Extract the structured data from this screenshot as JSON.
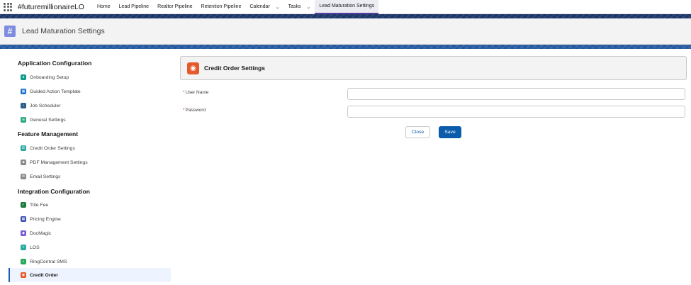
{
  "app": {
    "name": "#futuremillionaireLO",
    "nav": [
      {
        "label": "Home",
        "dropdown": false
      },
      {
        "label": "Lead Pipeline",
        "dropdown": false
      },
      {
        "label": "Realtor Pipeline",
        "dropdown": false
      },
      {
        "label": "Retention Pipeline",
        "dropdown": false
      },
      {
        "label": "Calendar",
        "dropdown": true
      },
      {
        "label": "Tasks",
        "dropdown": true
      },
      {
        "label": "Lead Maturation Settings",
        "dropdown": false,
        "active": true
      }
    ]
  },
  "page": {
    "title": "Lead Maturation Settings"
  },
  "sidebar": {
    "sections": [
      {
        "title": "Application Configuration",
        "items": [
          {
            "label": "Onboarding Setup",
            "icon": "onboarding-icon",
            "color": "#0f9d8a"
          },
          {
            "label": "Guided Action Template",
            "icon": "template-icon",
            "color": "#1b6fc9"
          },
          {
            "label": "Job Scheduler",
            "icon": "scheduler-icon",
            "color": "#2f5d8a"
          },
          {
            "label": "General Settings",
            "icon": "settings-icon",
            "color": "#2aa87f"
          }
        ]
      },
      {
        "title": "Feature Management",
        "items": [
          {
            "label": "Credit Order Settings",
            "icon": "credit-settings-icon",
            "color": "#2aa8a0"
          },
          {
            "label": "PDF Management Settings",
            "icon": "pdf-icon",
            "color": "#8a8a8a"
          },
          {
            "label": "Email Settings",
            "icon": "email-icon",
            "color": "#8a8a8a"
          }
        ]
      },
      {
        "title": "Integration Configuration",
        "items": [
          {
            "label": "Title Fee",
            "icon": "title-fee-icon",
            "color": "#1f7a3f"
          },
          {
            "label": "Pricing Engine",
            "icon": "pricing-icon",
            "color": "#3b4fb5"
          },
          {
            "label": "DocMagic",
            "icon": "docmagic-icon",
            "color": "#7a5cd6"
          },
          {
            "label": "LOS",
            "icon": "los-icon",
            "color": "#2aa8a0"
          },
          {
            "label": "RingCentral SMS",
            "icon": "sms-icon",
            "color": "#2aa85a"
          },
          {
            "label": "Credit Order",
            "icon": "credit-order-icon",
            "color": "#e55a2b",
            "selected": true
          }
        ]
      }
    ]
  },
  "main": {
    "card_title": "Credit Order Settings",
    "fields": [
      {
        "label": "User Name",
        "required": true,
        "value": "",
        "placeholder": ""
      },
      {
        "label": "Password",
        "required": true,
        "value": "",
        "placeholder": ""
      }
    ],
    "buttons": {
      "close": "Close",
      "save": "Save"
    }
  }
}
